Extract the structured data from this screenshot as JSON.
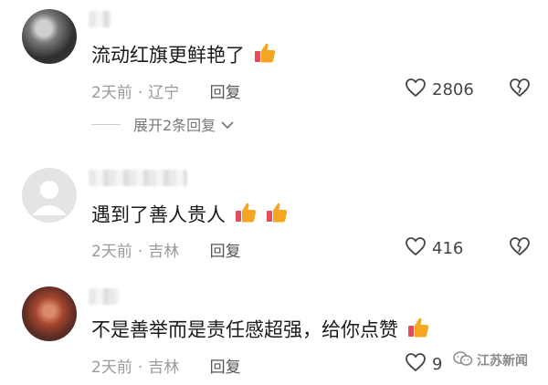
{
  "comments": [
    {
      "text": "流动红旗更鲜艳了",
      "time": "2天前",
      "location": "辽宁",
      "reply_label": "回复",
      "likes": "2806",
      "thumbs_count": 1
    },
    {
      "text": "遇到了善人贵人",
      "time": "2天前",
      "location": "吉林",
      "reply_label": "回复",
      "likes": "416",
      "thumbs_count": 2
    },
    {
      "text": "不是善举而是责任感超强，给你点赞",
      "time": "2天前",
      "location": "吉林",
      "reply_label": "回复",
      "likes": "9",
      "thumbs_count": 1
    }
  ],
  "expand_replies": "展开2条回复",
  "watermark": "江苏新闻",
  "colors": {
    "accent_thumb": "#f4a623",
    "thumb_cuff": "#e94a5a",
    "meta_gray": "#9a9a9a"
  },
  "icons": [
    "heart-outline-icon",
    "broken-heart-icon",
    "thumbs-up-icon",
    "chevron-down-icon",
    "default-avatar-icon"
  ]
}
